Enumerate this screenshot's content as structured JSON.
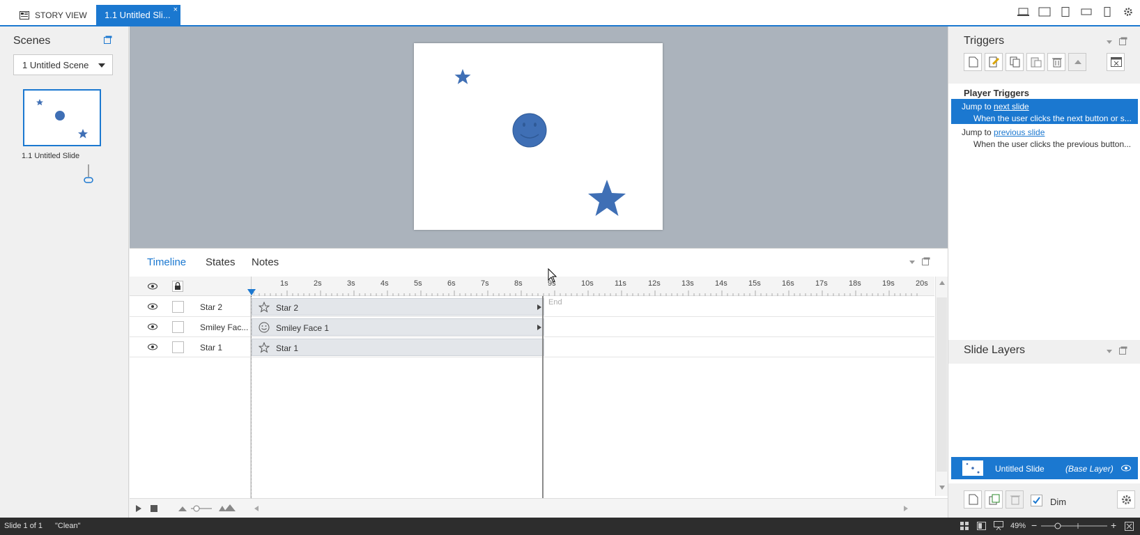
{
  "tabs": {
    "story_view": "STORY VIEW",
    "slide_tab": "1.1 Untitled Sli...",
    "close": "×"
  },
  "scenes": {
    "title": "Scenes",
    "selected_scene": "1 Untitled Scene",
    "thumb_label": "1.1 Untitled Slide"
  },
  "timeline": {
    "tabs": [
      "Timeline",
      "States",
      "Notes"
    ],
    "ticks": [
      "1s",
      "2s",
      "3s",
      "4s",
      "5s",
      "6s",
      "7s",
      "8s",
      "9s",
      "10s",
      "11s",
      "12s",
      "13s",
      "14s",
      "15s",
      "16s",
      "17s",
      "18s",
      "19s",
      "20s"
    ],
    "end_label": "End",
    "rows": [
      {
        "name": "Star 2",
        "bar_label": "Star 2",
        "icon": "star-outline-icon"
      },
      {
        "name": "Smiley Fac...",
        "bar_label": "Smiley Face 1",
        "icon": "smiley-outline-icon"
      },
      {
        "name": "Star 1",
        "bar_label": "Star 1",
        "icon": "star-outline-icon"
      }
    ]
  },
  "triggers": {
    "title": "Triggers",
    "group": "Player Triggers",
    "items": [
      {
        "prefix": "Jump to ",
        "link": "next slide",
        "detail": "When the user clicks the next button or s..."
      },
      {
        "prefix": "Jump to ",
        "link": "previous slide",
        "detail": "When the user clicks the previous button..."
      }
    ]
  },
  "layers": {
    "title": "Slide Layers",
    "base_name": "Untitled Slide",
    "base_tag": "(Base Layer)",
    "dim_label": "Dim"
  },
  "status": {
    "slide": "Slide 1 of 1",
    "theme": "\"Clean\"",
    "zoom": "49%"
  },
  "colors": {
    "accent": "#1b78d0",
    "shape": "#3f6fb5",
    "canvas_bg": "#abb3bc"
  }
}
